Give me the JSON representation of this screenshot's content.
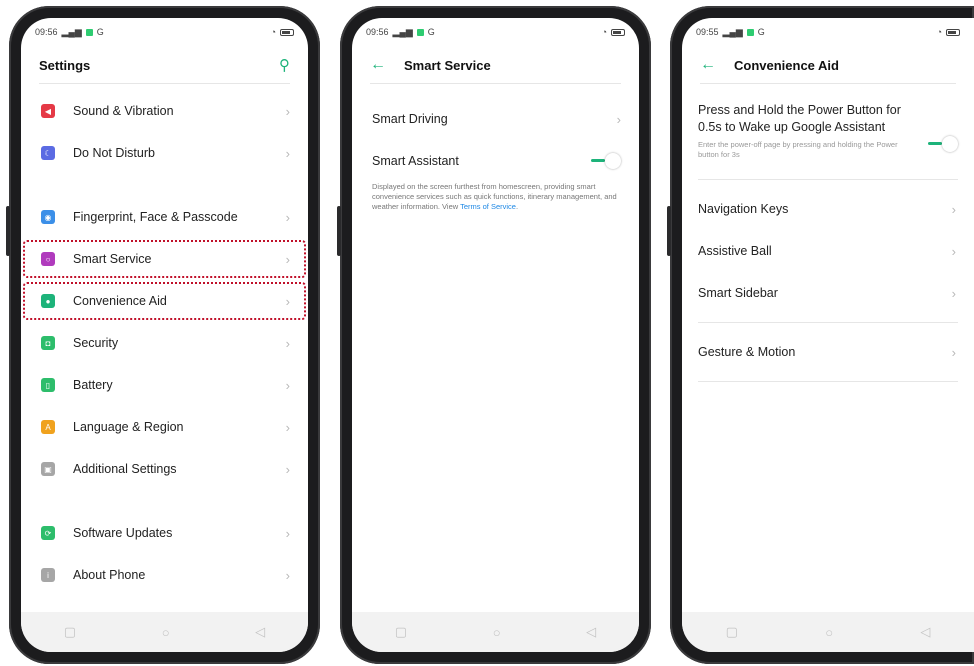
{
  "status": {
    "time": "09:56",
    "time_alt": "09:55",
    "left_text": "G"
  },
  "colors": {
    "accent": "#1db37a",
    "link": "#1e88e5",
    "highlight": "#c0102a"
  },
  "phone1": {
    "title": "Settings",
    "items": [
      {
        "label": "Sound & Vibration",
        "icon": "speaker-icon",
        "color": "#e53946"
      },
      {
        "label": "Do Not Disturb",
        "icon": "moon-icon",
        "color": "#5b6be3"
      },
      {
        "label": "Fingerprint, Face & Passcode",
        "icon": "fingerprint-icon",
        "color": "#3b8fe8"
      },
      {
        "label": "Smart Service",
        "icon": "smart-service-icon",
        "color": "#b03bbd"
      },
      {
        "label": "Convenience Aid",
        "icon": "convenience-aid-icon",
        "color": "#1db37a"
      },
      {
        "label": "Security",
        "icon": "security-icon",
        "color": "#2dbd6b"
      },
      {
        "label": "Battery",
        "icon": "battery-icon",
        "color": "#2dbd6b"
      },
      {
        "label": "Language & Region",
        "icon": "language-icon",
        "color": "#f0a21e"
      },
      {
        "label": "Additional Settings",
        "icon": "additional-settings-icon",
        "color": "#a6a6a6"
      },
      {
        "label": "Software Updates",
        "icon": "software-updates-icon",
        "color": "#2dbd6b"
      },
      {
        "label": "About Phone",
        "icon": "about-phone-icon",
        "color": "#a6a6a6"
      }
    ]
  },
  "phone2": {
    "title": "Smart Service",
    "items": [
      {
        "label": "Smart Driving"
      },
      {
        "label": "Smart Assistant"
      }
    ],
    "assistant_desc": "Displayed on the screen furthest from homescreen, providing smart convenience services such as quick functions, itinerary management, and weather information. View ",
    "assistant_link": "Terms of Service",
    "assistant_desc_end": "."
  },
  "phone3": {
    "title": "Convenience Aid",
    "power_title": "Press and Hold the Power Button for 0.5s to Wake up Google Assistant",
    "power_desc": "Enter the power-off page by pressing and holding the Power button for 3s",
    "items": [
      {
        "label": "Navigation Keys"
      },
      {
        "label": "Assistive Ball"
      },
      {
        "label": "Smart Sidebar"
      },
      {
        "label": "Gesture & Motion"
      }
    ]
  },
  "nav": {
    "recent": "▢",
    "home": "○",
    "back": "◁"
  }
}
